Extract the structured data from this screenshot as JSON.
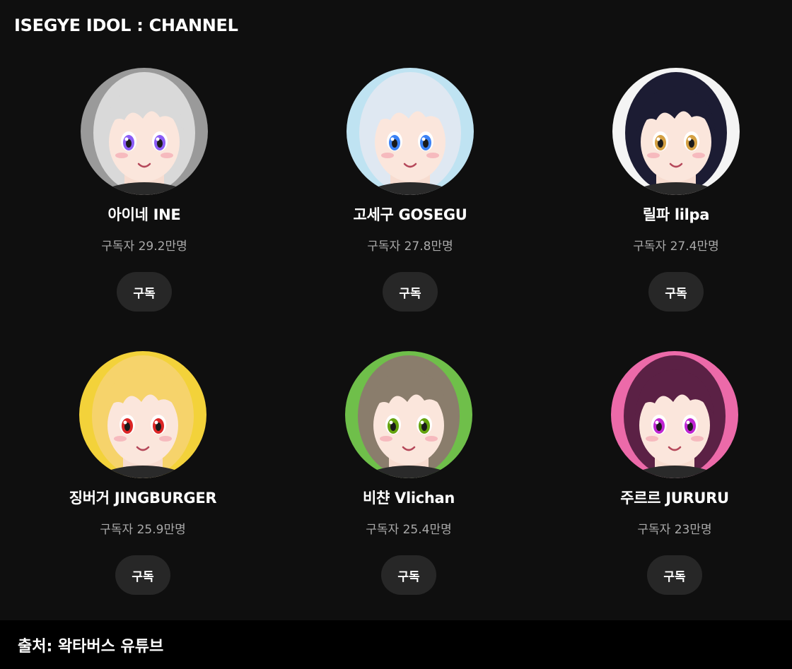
{
  "header": {
    "title": "ISEGYE IDOL : CHANNEL"
  },
  "channels": [
    {
      "name": "아이네 INE",
      "subscribers": "구독자 29.2만명",
      "subscribe_label": "구독",
      "avatar_icon": "avatar-ine-icon",
      "avatar_bg": "#9a9a9a",
      "hair": "#d9d9d9",
      "eye": "#8b5cf6"
    },
    {
      "name": "고세구 GOSEGU",
      "subscribers": "구독자 27.8만명",
      "subscribe_label": "구독",
      "avatar_icon": "avatar-gosegu-icon",
      "avatar_bg": "#bfe3f2",
      "hair": "#dfe8f2",
      "eye": "#3b82f6"
    },
    {
      "name": "릴파 lilpa",
      "subscribers": "구독자 27.4만명",
      "subscribe_label": "구독",
      "avatar_icon": "avatar-lilpa-icon",
      "avatar_bg": "#f4f4f4",
      "hair": "#1c1c33",
      "eye": "#d4a043"
    },
    {
      "name": "징버거 JINGBURGER",
      "subscribers": "구독자 25.9만명",
      "subscribe_label": "구독",
      "avatar_icon": "avatar-jingburger-icon",
      "avatar_bg": "#f3d23a",
      "hair": "#f6d36b",
      "eye": "#dc2626"
    },
    {
      "name": "비챤 Vlichan",
      "subscribers": "구독자 25.4만명",
      "subscribe_label": "구독",
      "avatar_icon": "avatar-viichan-icon",
      "avatar_bg": "#6fbf4a",
      "hair": "#8a7d6c",
      "eye": "#65a30d"
    },
    {
      "name": "주르르 JURURU",
      "subscribers": "구독자 23만명",
      "subscribe_label": "구독",
      "avatar_icon": "avatar-jururu-icon",
      "avatar_bg": "#ec6aa9",
      "hair": "#5b2145",
      "eye": "#c026d3"
    }
  ],
  "footer": {
    "source": "출처: 왁타버스 유튜브"
  }
}
